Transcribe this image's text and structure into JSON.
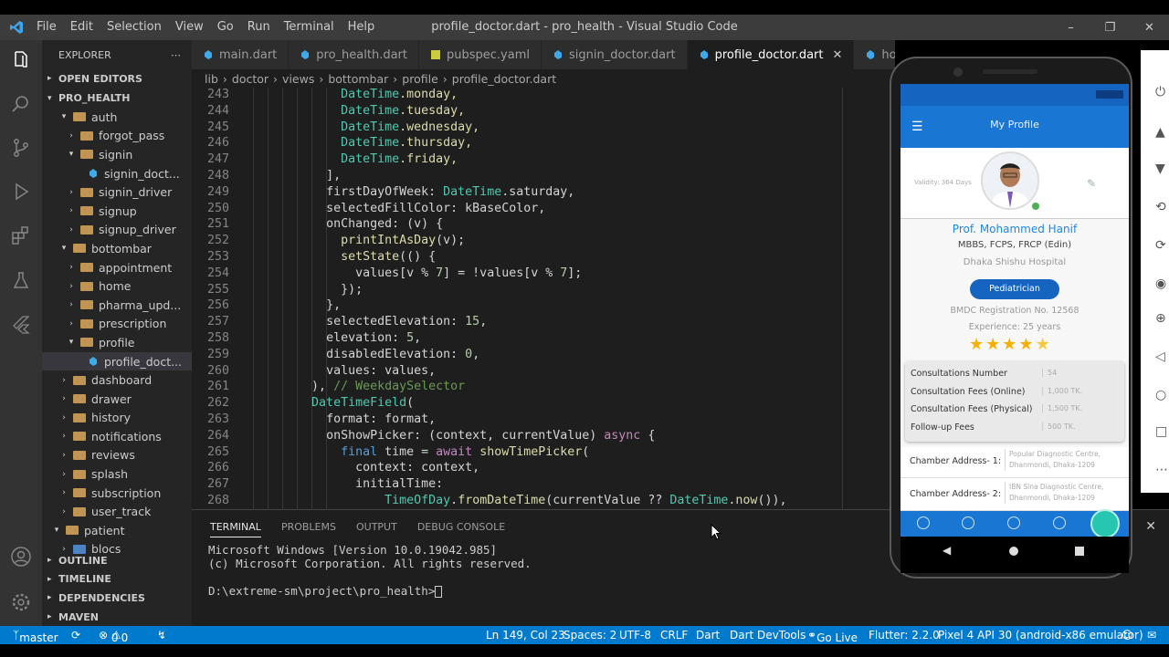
{
  "window": {
    "title": "profile_doctor.dart - pro_health - Visual Studio Code",
    "menu": [
      "File",
      "Edit",
      "Selection",
      "View",
      "Go",
      "Run",
      "Terminal",
      "Help"
    ]
  },
  "explorer": {
    "header": "EXPLORER",
    "open_editors": "OPEN EDITORS",
    "project": "PRO_HEALTH",
    "tree": [
      {
        "label": "auth",
        "indent": 2,
        "type": "folder",
        "open": true
      },
      {
        "label": "forgot_pass",
        "indent": 3,
        "type": "folder",
        "open": false
      },
      {
        "label": "signin",
        "indent": 3,
        "type": "folder",
        "open": true
      },
      {
        "label": "signin_doct...",
        "indent": 4,
        "type": "dart"
      },
      {
        "label": "signin_driver",
        "indent": 3,
        "type": "folder",
        "open": false
      },
      {
        "label": "signup",
        "indent": 3,
        "type": "folder",
        "open": false
      },
      {
        "label": "signup_driver",
        "indent": 3,
        "type": "folder",
        "open": false
      },
      {
        "label": "bottombar",
        "indent": 2,
        "type": "folder",
        "open": true
      },
      {
        "label": "appointment",
        "indent": 3,
        "type": "folder",
        "open": false
      },
      {
        "label": "home",
        "indent": 3,
        "type": "folder",
        "open": false
      },
      {
        "label": "pharma_upd...",
        "indent": 3,
        "type": "folder",
        "open": false
      },
      {
        "label": "prescription",
        "indent": 3,
        "type": "folder",
        "open": false
      },
      {
        "label": "profile",
        "indent": 3,
        "type": "folder",
        "open": true
      },
      {
        "label": "profile_doct...",
        "indent": 4,
        "type": "dart",
        "selected": true
      },
      {
        "label": "dashboard",
        "indent": 2,
        "type": "folder",
        "open": false
      },
      {
        "label": "drawer",
        "indent": 2,
        "type": "folder",
        "open": false
      },
      {
        "label": "history",
        "indent": 2,
        "type": "folder",
        "open": false
      },
      {
        "label": "notifications",
        "indent": 2,
        "type": "folder",
        "open": false,
        "special": true
      },
      {
        "label": "reviews",
        "indent": 2,
        "type": "folder",
        "open": false
      },
      {
        "label": "splash",
        "indent": 2,
        "type": "folder",
        "open": false
      },
      {
        "label": "subscription",
        "indent": 2,
        "type": "folder",
        "open": false
      },
      {
        "label": "user_track",
        "indent": 2,
        "type": "folder",
        "open": false
      },
      {
        "label": "patient",
        "indent": 1,
        "type": "folder",
        "open": true
      },
      {
        "label": "blocs",
        "indent": 2,
        "type": "folder",
        "open": false,
        "blue": true
      }
    ],
    "sections": [
      "OUTLINE",
      "TIMELINE",
      "DEPENDENCIES",
      "MAVEN"
    ]
  },
  "tabs": [
    {
      "label": "main.dart",
      "active": false,
      "icon": "dart"
    },
    {
      "label": "pro_health.dart",
      "active": false,
      "icon": "dart"
    },
    {
      "label": "pubspec.yaml",
      "active": false,
      "icon": "yaml"
    },
    {
      "label": "signin_doctor.dart",
      "active": false,
      "icon": "dart"
    },
    {
      "label": "profile_doctor.dart",
      "active": true,
      "icon": "dart"
    },
    {
      "label": "home_docto",
      "active": false,
      "icon": "dart"
    }
  ],
  "breadcrumbs": [
    "lib",
    "›",
    "doctor",
    "›",
    "views",
    "›",
    "bottombar",
    "›",
    "profile",
    "›",
    "profile_doctor.dart"
  ],
  "code_lines": [
    {
      "n": "243",
      "t": [
        [
          "            ",
          ""
        ],
        [
          "DateTime",
          "#4ec9b0"
        ],
        [
          ".monday,",
          "#dcdcaa"
        ]
      ]
    },
    {
      "n": "244",
      "t": [
        [
          "            ",
          ""
        ],
        [
          "DateTime",
          "#4ec9b0"
        ],
        [
          ".tuesday,",
          "#dcdcaa"
        ]
      ]
    },
    {
      "n": "245",
      "t": [
        [
          "            ",
          ""
        ],
        [
          "DateTime",
          "#4ec9b0"
        ],
        [
          ".wednesday,",
          "#dcdcaa"
        ]
      ]
    },
    {
      "n": "246",
      "t": [
        [
          "            ",
          ""
        ],
        [
          "DateTime",
          "#4ec9b0"
        ],
        [
          ".thursday,",
          "#dcdcaa"
        ]
      ]
    },
    {
      "n": "247",
      "t": [
        [
          "            ",
          ""
        ],
        [
          "DateTime",
          "#4ec9b0"
        ],
        [
          ".friday,",
          "#dcdcaa"
        ]
      ]
    },
    {
      "n": "248",
      "t": [
        [
          "          ",
          ""
        ],
        [
          "],",
          "#d4d4d4"
        ]
      ]
    },
    {
      "n": "249",
      "t": [
        [
          "          ",
          ""
        ],
        [
          "firstDayOfWeek: ",
          "#d4d4d4"
        ],
        [
          "DateTime",
          "#4ec9b0"
        ],
        [
          ".saturday,",
          "#d4d4d4"
        ]
      ]
    },
    {
      "n": "250",
      "t": [
        [
          "          ",
          ""
        ],
        [
          "selectedFillColor: kBaseColor,",
          "#d4d4d4"
        ]
      ]
    },
    {
      "n": "251",
      "t": [
        [
          "          ",
          ""
        ],
        [
          "onChanged: (v) {",
          "#d4d4d4"
        ]
      ]
    },
    {
      "n": "252",
      "t": [
        [
          "            ",
          ""
        ],
        [
          "printIntAsDay",
          "#dcdcaa"
        ],
        [
          "(v);",
          "#d4d4d4"
        ]
      ]
    },
    {
      "n": "253",
      "t": [
        [
          "            ",
          ""
        ],
        [
          "setState",
          "#dcdcaa"
        ],
        [
          "(() {",
          "#d4d4d4"
        ]
      ]
    },
    {
      "n": "254",
      "t": [
        [
          "              ",
          ""
        ],
        [
          "values[v % ",
          "#d4d4d4"
        ],
        [
          "7",
          "#b5cea8"
        ],
        [
          "] = !values[v % ",
          "#d4d4d4"
        ],
        [
          "7",
          "#b5cea8"
        ],
        [
          "];",
          "#d4d4d4"
        ]
      ]
    },
    {
      "n": "255",
      "t": [
        [
          "            ",
          ""
        ],
        [
          "});",
          "#d4d4d4"
        ]
      ]
    },
    {
      "n": "256",
      "t": [
        [
          "          ",
          ""
        ],
        [
          "},",
          "#d4d4d4"
        ]
      ]
    },
    {
      "n": "257",
      "t": [
        [
          "          ",
          ""
        ],
        [
          "selectedElevation: ",
          "#d4d4d4"
        ],
        [
          "15",
          "#b5cea8"
        ],
        [
          ",",
          "#d4d4d4"
        ]
      ]
    },
    {
      "n": "258",
      "t": [
        [
          "          ",
          ""
        ],
        [
          "elevation: ",
          "#d4d4d4"
        ],
        [
          "5",
          "#b5cea8"
        ],
        [
          ",",
          "#d4d4d4"
        ]
      ]
    },
    {
      "n": "259",
      "t": [
        [
          "          ",
          ""
        ],
        [
          "disabledElevation: ",
          "#d4d4d4"
        ],
        [
          "0",
          "#b5cea8"
        ],
        [
          ",",
          "#d4d4d4"
        ]
      ]
    },
    {
      "n": "260",
      "t": [
        [
          "          ",
          ""
        ],
        [
          "values: values,",
          "#d4d4d4"
        ]
      ]
    },
    {
      "n": "261",
      "t": [
        [
          "        ",
          ""
        ],
        [
          "), ",
          "#d4d4d4"
        ],
        [
          "// WeekdaySelector",
          "#6a9955"
        ]
      ]
    },
    {
      "n": "262",
      "t": [
        [
          "        ",
          ""
        ],
        [
          "DateTimeField",
          "#4ec9b0"
        ],
        [
          "(",
          "#d4d4d4"
        ]
      ]
    },
    {
      "n": "263",
      "t": [
        [
          "          ",
          ""
        ],
        [
          "format: format,",
          "#d4d4d4"
        ]
      ]
    },
    {
      "n": "264",
      "t": [
        [
          "          ",
          ""
        ],
        [
          "onShowPicker: (context, currentValue) ",
          "#d4d4d4"
        ],
        [
          "async",
          "#c586c0"
        ],
        [
          " {",
          "#d4d4d4"
        ]
      ]
    },
    {
      "n": "265",
      "t": [
        [
          "            ",
          ""
        ],
        [
          "final",
          "#569cd6"
        ],
        [
          " time = ",
          "#d4d4d4"
        ],
        [
          "await",
          "#c586c0"
        ],
        [
          " ",
          "#d4d4d4"
        ],
        [
          "showTimePicker",
          "#dcdcaa"
        ],
        [
          "(",
          "#d4d4d4"
        ]
      ]
    },
    {
      "n": "266",
      "t": [
        [
          "              ",
          ""
        ],
        [
          "context: context,",
          "#d4d4d4"
        ]
      ]
    },
    {
      "n": "267",
      "t": [
        [
          "              ",
          ""
        ],
        [
          "initialTime:",
          "#d4d4d4"
        ]
      ]
    },
    {
      "n": "268",
      "t": [
        [
          "                  ",
          ""
        ],
        [
          "TimeOfDay",
          "#4ec9b0"
        ],
        [
          ".",
          "#d4d4d4"
        ],
        [
          "fromDateTime",
          "#dcdcaa"
        ],
        [
          "(currentValue ?? ",
          "#d4d4d4"
        ],
        [
          "DateTime",
          "#4ec9b0"
        ],
        [
          ".",
          "#d4d4d4"
        ],
        [
          "now",
          "#dcdcaa"
        ],
        [
          "()),",
          "#d4d4d4"
        ]
      ]
    }
  ],
  "panel": {
    "tabs": [
      "TERMINAL",
      "PROBLEMS",
      "OUTPUT",
      "DEBUG CONSOLE"
    ],
    "terminal": "Microsoft Windows [Version 10.0.19042.985]\n(c) Microsoft Corporation. All rights reserved.\n\nD:\\extreme-sm\\project\\pro_health>"
  },
  "status": {
    "branch": "master",
    "errors": "0",
    "warnings": "0",
    "position": "Ln 149, Col 23",
    "spaces": "Spaces: 2",
    "encoding": "UTF-8",
    "eol": "CRLF",
    "language": "Dart",
    "devtools": "Dart DevTools",
    "golive": "Go Live",
    "flutter": "Flutter: 2.2.0",
    "device": "Pixel 4 API 30 (android-x86 emulator)"
  },
  "phone": {
    "appbar_title": "My Profile",
    "validity": "Validity: 364 Days",
    "name": "Prof. Mohammed Hanif",
    "degrees": "MBBS, FCPS, FRCP (Edin)",
    "hospital": "Dhaka Shishu Hospital",
    "specialty": "Pediatrician",
    "bmdc": "BMDC Registration No. 12568",
    "experience": "Experience: 25 years",
    "rating": 4.5,
    "stats": [
      {
        "label": "Consultations Number",
        "value": "54"
      },
      {
        "label": "Consultation Fees (Online)",
        "value": "1,000 TK."
      },
      {
        "label": "Consultation Fees (Physical)",
        "value": "1,500 TK."
      },
      {
        "label": "Follow-up Fees",
        "value": "500 TK."
      }
    ],
    "chambers": [
      {
        "label": "Chamber Address- 1:",
        "value": "Popular Diagnostic Centre, Dhanmondi, Dhaka-1209"
      },
      {
        "label": "Chamber Address- 2:",
        "value": "IBN Sina Diagnostic Centre, Dhanmondi, Dhaka-1209"
      }
    ],
    "colors": {
      "primary": "#1565c0",
      "fab": "#26c6b0"
    }
  }
}
